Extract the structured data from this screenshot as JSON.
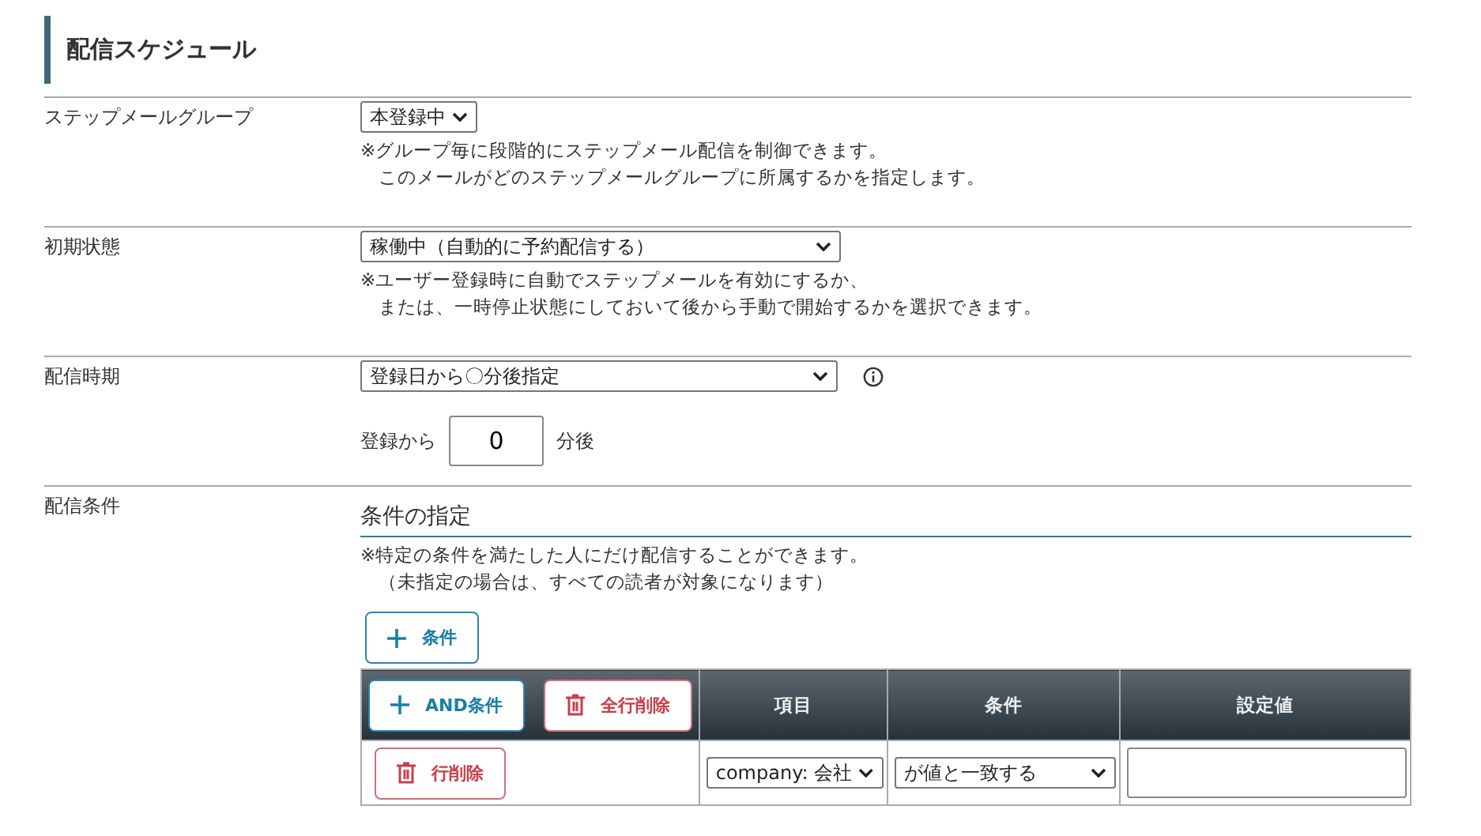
{
  "section_title": "配信スケジュール",
  "rows": [
    {
      "kind": "select",
      "label": "ステップメールグループ",
      "value": "本登録中",
      "notes": [
        "※グループ毎に段階的にステップメール配信を制御できます。",
        "このメールがどのステップメールグループに所属するかを指定します。"
      ]
    },
    {
      "kind": "wide_select",
      "label": "初期状態",
      "value": "稼働中（自動的に予約配信する）",
      "notes": [
        "※ユーザー登録時に自動でステップメールを有効にするか、",
        "または、一時停止状態にしておいて後から手動で開始するかを選択できます。"
      ]
    },
    {
      "kind": "timing",
      "label": "配信時期",
      "value": "登録日から〇分後指定",
      "prefix": "登録から",
      "input_value": "0",
      "suffix": "分後"
    },
    {
      "kind": "conditions",
      "label": "配信条件",
      "heading": "条件の指定",
      "notes": [
        "※特定の条件を満たした人にだけ配信することができます。",
        "（未指定の場合は、すべての読者が対象になります）"
      ],
      "add_button": "条件",
      "and_button": "AND条件",
      "delete_all_button": "全行削除",
      "columns": [
        "項目",
        "条件",
        "設定値"
      ],
      "table_rows": [
        {
          "delete_button": "行削除",
          "item": "company: 会社",
          "condition": "が値と一致する"
        }
      ]
    }
  ]
}
